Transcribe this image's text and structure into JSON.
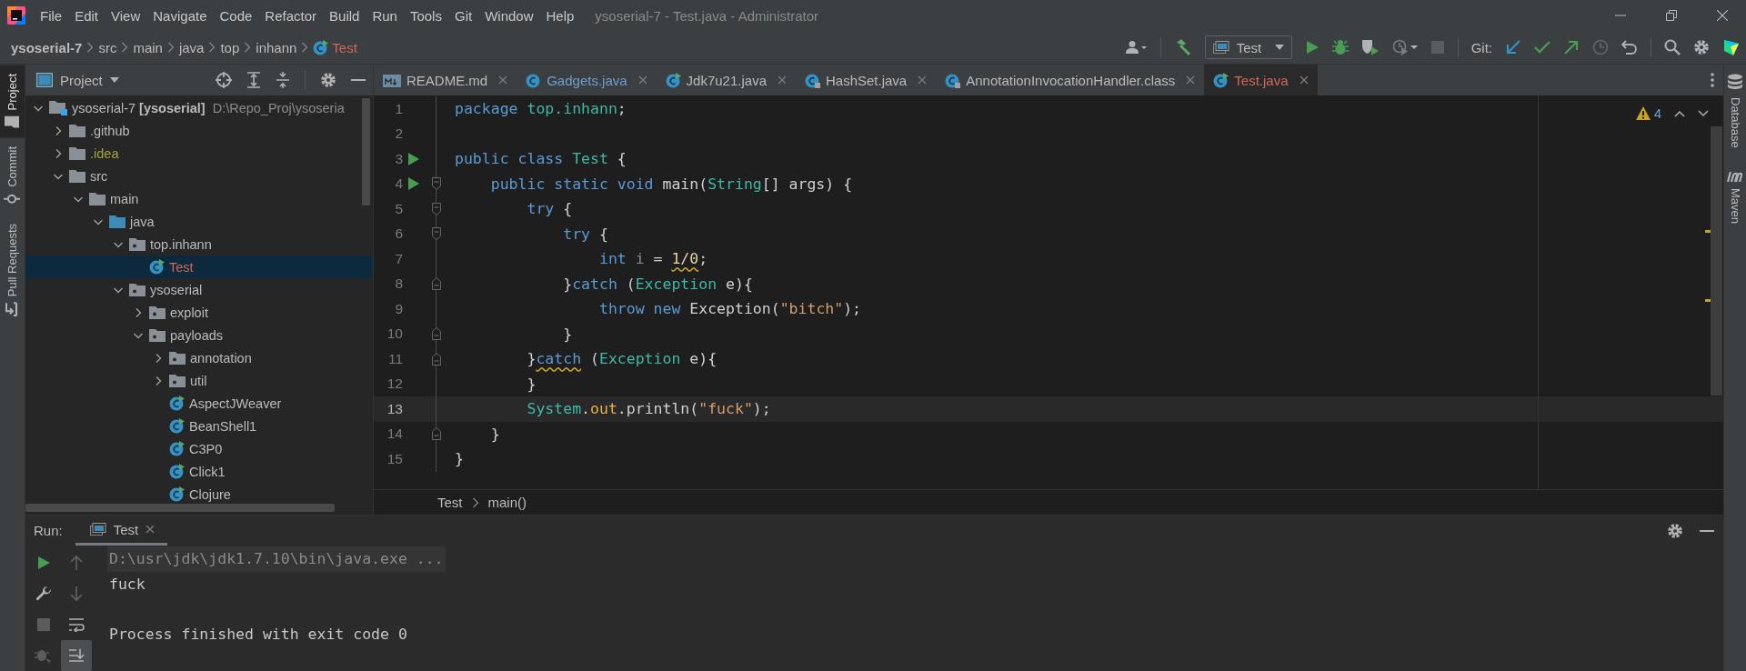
{
  "window": {
    "title": "ysoserial-7 - Test.java - Administrator",
    "menu": [
      {
        "label": "File"
      },
      {
        "label": "Edit"
      },
      {
        "label": "View"
      },
      {
        "label": "Navigate"
      },
      {
        "label": "Code"
      },
      {
        "label": "Refactor"
      },
      {
        "label": "Build"
      },
      {
        "label": "Run"
      },
      {
        "label": "Tools"
      },
      {
        "label": "Git"
      },
      {
        "label": "Window"
      },
      {
        "label": "Help"
      }
    ]
  },
  "navigation_bar": {
    "path": [
      {
        "label": "ysoserial-7",
        "kind": "module"
      },
      {
        "label": "src",
        "kind": "folder"
      },
      {
        "label": "main",
        "kind": "folder"
      },
      {
        "label": "java",
        "kind": "folder"
      },
      {
        "label": "top",
        "kind": "folder"
      },
      {
        "label": "inhann",
        "kind": "folder"
      },
      {
        "label": "Test",
        "kind": "class",
        "unversioned": true
      }
    ],
    "run_configuration": "Test",
    "git_label": "Git:"
  },
  "left_stripe": [
    {
      "label": "Project",
      "kind": "project",
      "selected": true
    },
    {
      "label": "Commit",
      "kind": "commit",
      "selected": false
    },
    {
      "label": "Pull Requests",
      "kind": "pull_requests",
      "selected": false
    }
  ],
  "project_panel": {
    "title": "Project",
    "tree": [
      {
        "label": "ysoserial-7",
        "module": "[ysoserial]",
        "path": "D:\\Repo_Proj\\ysoseria",
        "kind": "module",
        "expanded": true,
        "selected": false,
        "children": [
          {
            "label": ".github",
            "kind": "folder",
            "expanded": false,
            "selected": false
          },
          {
            "label": ".idea",
            "kind": "folder",
            "expanded": false,
            "selected": false,
            "ignored": true
          },
          {
            "label": "src",
            "kind": "folder",
            "expanded": true,
            "selected": false,
            "children": [
              {
                "label": "main",
                "kind": "folder",
                "expanded": true,
                "selected": false,
                "children": [
                  {
                    "label": "java",
                    "kind": "source_root",
                    "expanded": true,
                    "selected": false,
                    "children": [
                      {
                        "label": "top.inhann",
                        "kind": "package",
                        "expanded": true,
                        "selected": false,
                        "children": [
                          {
                            "label": "Test",
                            "kind": "runnable_class",
                            "selected": true,
                            "unversioned": true
                          }
                        ]
                      },
                      {
                        "label": "ysoserial",
                        "kind": "package",
                        "expanded": true,
                        "selected": false,
                        "children": [
                          {
                            "label": "exploit",
                            "kind": "package",
                            "expanded": false,
                            "selected": false
                          },
                          {
                            "label": "payloads",
                            "kind": "package",
                            "expanded": true,
                            "selected": false,
                            "children": [
                              {
                                "label": "annotation",
                                "kind": "package",
                                "expanded": false,
                                "selected": false
                              },
                              {
                                "label": "util",
                                "kind": "package",
                                "expanded": false,
                                "selected": false
                              },
                              {
                                "label": "AspectJWeaver",
                                "kind": "runnable_class",
                                "selected": false
                              },
                              {
                                "label": "BeanShell1",
                                "kind": "runnable_class",
                                "selected": false
                              },
                              {
                                "label": "C3P0",
                                "kind": "runnable_class",
                                "selected": false
                              },
                              {
                                "label": "Click1",
                                "kind": "runnable_class",
                                "selected": false
                              },
                              {
                                "label": "Clojure",
                                "kind": "runnable_class",
                                "selected": false
                              }
                            ]
                          }
                        ]
                      }
                    ]
                  }
                ]
              }
            ]
          }
        ]
      }
    ]
  },
  "editor": {
    "tabs": [
      {
        "label": "README.md",
        "kind": "markdown",
        "selected": false
      },
      {
        "label": "Gadgets.java",
        "kind": "class",
        "selected": false,
        "modified": true
      },
      {
        "label": "Jdk7u21.java",
        "kind": "runnable_class",
        "selected": false
      },
      {
        "label": "HashSet.java",
        "kind": "library_class",
        "selected": false
      },
      {
        "label": "AnnotationInvocationHandler.class",
        "kind": "library_class",
        "selected": false
      },
      {
        "label": "Test.java",
        "kind": "runnable_class",
        "selected": true,
        "unversioned": true
      }
    ],
    "warning_count": "4",
    "lines": [
      {
        "number": "1",
        "run_marker": false,
        "current": false,
        "tokens": [
          {
            "text": "package ",
            "kind": "keyword"
          },
          {
            "text": "top.inhann",
            "kind": "type"
          },
          {
            "text": ";",
            "kind": "plain"
          }
        ]
      },
      {
        "number": "2",
        "run_marker": false,
        "current": false
      },
      {
        "number": "3",
        "run_marker": true,
        "current": false,
        "tokens": [
          {
            "text": "public class ",
            "kind": "keyword"
          },
          {
            "text": "Test",
            "kind": "type"
          },
          {
            "text": " {",
            "kind": "plain"
          }
        ]
      },
      {
        "number": "4",
        "run_marker": true,
        "current": false,
        "fold_start": true,
        "tokens": [
          {
            "text": "    public static void",
            "kind": "keyword"
          },
          {
            "text": " main(",
            "kind": "plain"
          },
          {
            "text": "String",
            "kind": "type"
          },
          {
            "text": "[] args) {",
            "kind": "plain"
          }
        ]
      },
      {
        "number": "5",
        "run_marker": false,
        "current": false,
        "fold_start": true,
        "tokens": [
          {
            "text": "        try",
            "kind": "keyword"
          },
          {
            "text": " {",
            "kind": "plain"
          }
        ]
      },
      {
        "number": "6",
        "run_marker": false,
        "current": false,
        "fold_start": true,
        "tokens": [
          {
            "text": "            try",
            "kind": "keyword"
          },
          {
            "text": " {",
            "kind": "plain"
          }
        ]
      },
      {
        "number": "7",
        "run_marker": false,
        "current": false,
        "tokens": [
          {
            "text": "                int ",
            "kind": "keyword"
          },
          {
            "text": "i",
            "kind": "unused"
          },
          {
            "text": " = ",
            "kind": "plain"
          },
          {
            "text": "1/0",
            "kind": "number",
            "warning": true
          },
          {
            "text": ";",
            "kind": "plain"
          }
        ]
      },
      {
        "number": "8",
        "run_marker": false,
        "current": false,
        "fold_end": true,
        "tokens": [
          {
            "text": "            }",
            "kind": "plain"
          },
          {
            "text": "catch",
            "kind": "keyword"
          },
          {
            "text": " (",
            "kind": "plain"
          },
          {
            "text": "Exception",
            "kind": "type"
          },
          {
            "text": " e){",
            "kind": "plain"
          }
        ]
      },
      {
        "number": "9",
        "run_marker": false,
        "current": false,
        "tokens": [
          {
            "text": "                throw new",
            "kind": "keyword"
          },
          {
            "text": " Exception(",
            "kind": "plain"
          },
          {
            "text": "\"bitch\"",
            "kind": "string"
          },
          {
            "text": ");",
            "kind": "plain"
          }
        ]
      },
      {
        "number": "10",
        "run_marker": false,
        "current": false,
        "fold_end": true,
        "tokens": [
          {
            "text": "            }",
            "kind": "plain"
          }
        ]
      },
      {
        "number": "11",
        "run_marker": false,
        "current": false,
        "fold_end": true,
        "tokens": [
          {
            "text": "        }",
            "kind": "plain"
          },
          {
            "text": "catch",
            "kind": "keyword",
            "warning": true
          },
          {
            "text": " (",
            "kind": "plain"
          },
          {
            "text": "Exception",
            "kind": "type"
          },
          {
            "text": " e){",
            "kind": "plain"
          }
        ]
      },
      {
        "number": "12",
        "run_marker": false,
        "current": false,
        "tokens": [
          {
            "text": "        }",
            "kind": "plain"
          }
        ]
      },
      {
        "number": "13",
        "run_marker": false,
        "current": true,
        "tokens": [
          {
            "text": "        System",
            "kind": "type"
          },
          {
            "text": ".",
            "kind": "plain"
          },
          {
            "text": "out",
            "kind": "field"
          },
          {
            "text": ".println(",
            "kind": "plain"
          },
          {
            "text": "\"fuck\"",
            "kind": "string"
          },
          {
            "text": ");",
            "kind": "plain"
          }
        ]
      },
      {
        "number": "14",
        "run_marker": false,
        "current": false,
        "fold_end": true,
        "tokens": [
          {
            "text": "    }",
            "kind": "plain"
          }
        ]
      },
      {
        "number": "15",
        "run_marker": false,
        "current": false,
        "tokens": [
          {
            "text": "}",
            "kind": "plain"
          }
        ]
      }
    ],
    "breadcrumb": [
      {
        "label": "Test"
      },
      {
        "label": "main()"
      }
    ]
  },
  "right_stripe": [
    {
      "label": "Database",
      "kind": "database"
    },
    {
      "label": "Maven",
      "kind": "maven"
    }
  ],
  "run_panel": {
    "title": "Run:",
    "tabs": [
      {
        "label": "Test",
        "selected": true
      }
    ],
    "console": [
      {
        "text": "D:\\usr\\jdk\\jdk1.7.10\\bin\\java.exe ...",
        "kind": "command"
      },
      {
        "text": "fuck",
        "kind": "output"
      },
      {
        "text": "Process finished with exit code 0",
        "kind": "system"
      }
    ]
  }
}
